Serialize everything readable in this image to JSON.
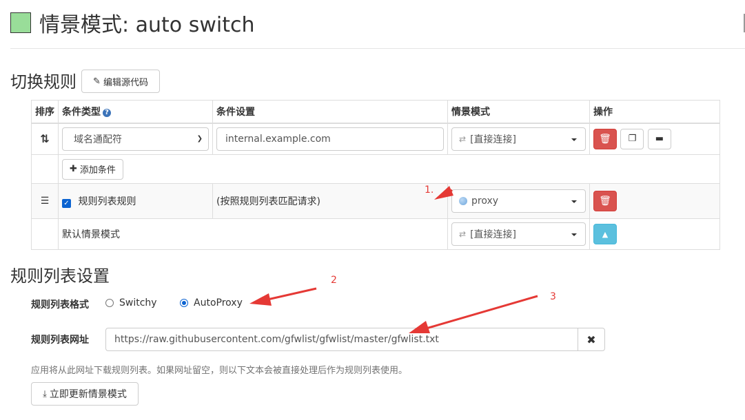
{
  "header": {
    "swatch_color": "#99dd99",
    "title": "情景模式: auto switch"
  },
  "switch_rules": {
    "title": "切换规则",
    "edit_source_button": "编辑源代码",
    "columns": [
      "排序",
      "条件类型",
      "条件设置",
      "情景模式",
      "操作"
    ],
    "rule": {
      "condition_type": "域名通配符",
      "condition_value": "internal.example.com",
      "profile": "[直接连接]"
    },
    "add_condition_button": "添加条件",
    "rule_list_row": {
      "label": "规则列表规则",
      "checked": true,
      "description": "(按照规则列表匹配请求)",
      "profile": "proxy"
    },
    "default_row": {
      "label": "默认情景模式",
      "profile": "[直接连接]"
    }
  },
  "rule_list_settings": {
    "title": "规则列表设置",
    "format_label": "规则列表格式",
    "format_options": [
      {
        "label": "Switchy",
        "selected": false
      },
      {
        "label": "AutoProxy",
        "selected": true
      }
    ],
    "url_label": "规则列表网址",
    "url_value": "https://raw.githubusercontent.com/gfwlist/gfwlist/master/gfwlist.txt",
    "help_text": "应用将从此网址下载规则列表。如果网址留空，则以下文本会被直接处理后作为规则列表使用。",
    "update_button": "立即更新情景模式"
  },
  "annotations": {
    "color": "#e53935",
    "labels": [
      "1.",
      "2",
      "3"
    ]
  }
}
